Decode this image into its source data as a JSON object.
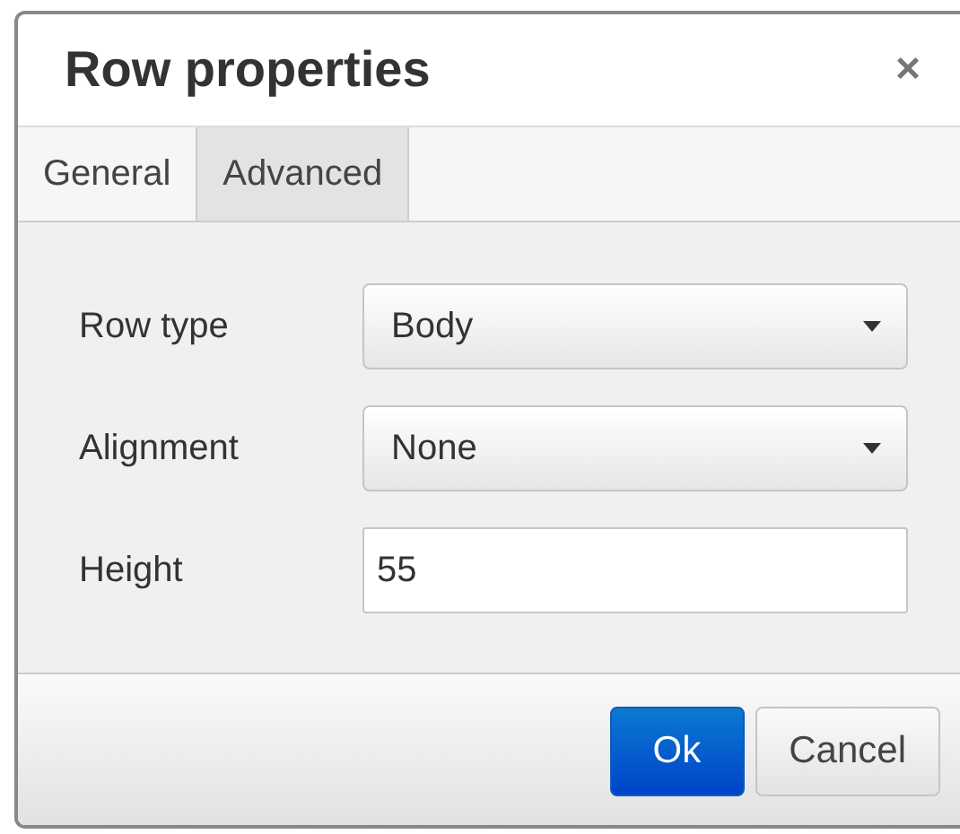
{
  "dialog": {
    "title": "Row properties",
    "close": "×"
  },
  "tabs": [
    {
      "label": "General",
      "selected": true
    },
    {
      "label": "Advanced",
      "selected": false
    }
  ],
  "fields": [
    {
      "kind": "select",
      "label": "Row type",
      "value": "Body"
    },
    {
      "kind": "select",
      "label": "Alignment",
      "value": "None"
    },
    {
      "kind": "text",
      "label": "Height",
      "value": "55"
    }
  ],
  "buttons": [
    {
      "label": "Ok",
      "primary": true
    },
    {
      "label": "Cancel",
      "primary": false
    }
  ]
}
